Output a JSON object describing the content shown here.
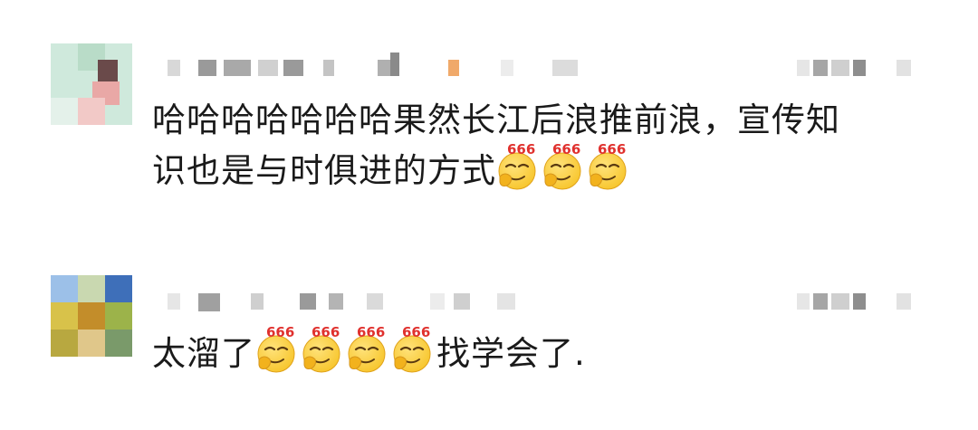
{
  "comments": [
    {
      "text": "哈哈哈哈哈哈哈果然长江后浪推前浪，宣传知",
      "text_line2": "识也是与时俱进的方式",
      "emoji_count": 3,
      "emoji_name": "666-emoji"
    },
    {
      "text_before": "太溜了",
      "emoji_count": 4,
      "text_after": "找学会了.",
      "emoji_name": "666-emoji"
    }
  ],
  "emoji_badge": "666",
  "colors": {
    "text": "#1a1a1a",
    "emoji_face": "#f7c52b",
    "emoji_badge": "#e0312e"
  }
}
